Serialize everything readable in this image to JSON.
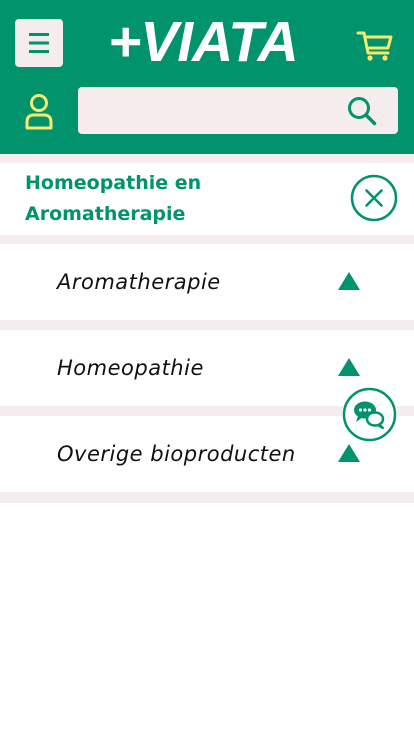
{
  "header": {
    "logo_text": "+VIATA",
    "menu_icon": "hamburger-menu-icon",
    "cart_icon": "cart-icon",
    "account_icon": "user-icon",
    "search": {
      "placeholder": "",
      "value": "",
      "icon": "search-icon"
    }
  },
  "category": {
    "title_line1": "Homeopathie en",
    "title_line2": "Aromatherapie",
    "close_icon": "close-circle-icon"
  },
  "subcategories": [
    {
      "label": "Aromatherapie",
      "icon": "triangle-up-icon"
    },
    {
      "label": "Homeopathie",
      "icon": "triangle-up-icon"
    },
    {
      "label": "Overige bioproducten",
      "icon": "triangle-up-icon"
    }
  ],
  "chat": {
    "icon": "chat-bubbles-icon"
  },
  "colors": {
    "brand_green": "#00936c",
    "band_pink": "#f5eded",
    "icon_yellow": "#f7e96b",
    "text": "#111111",
    "background": "#ffffff"
  }
}
